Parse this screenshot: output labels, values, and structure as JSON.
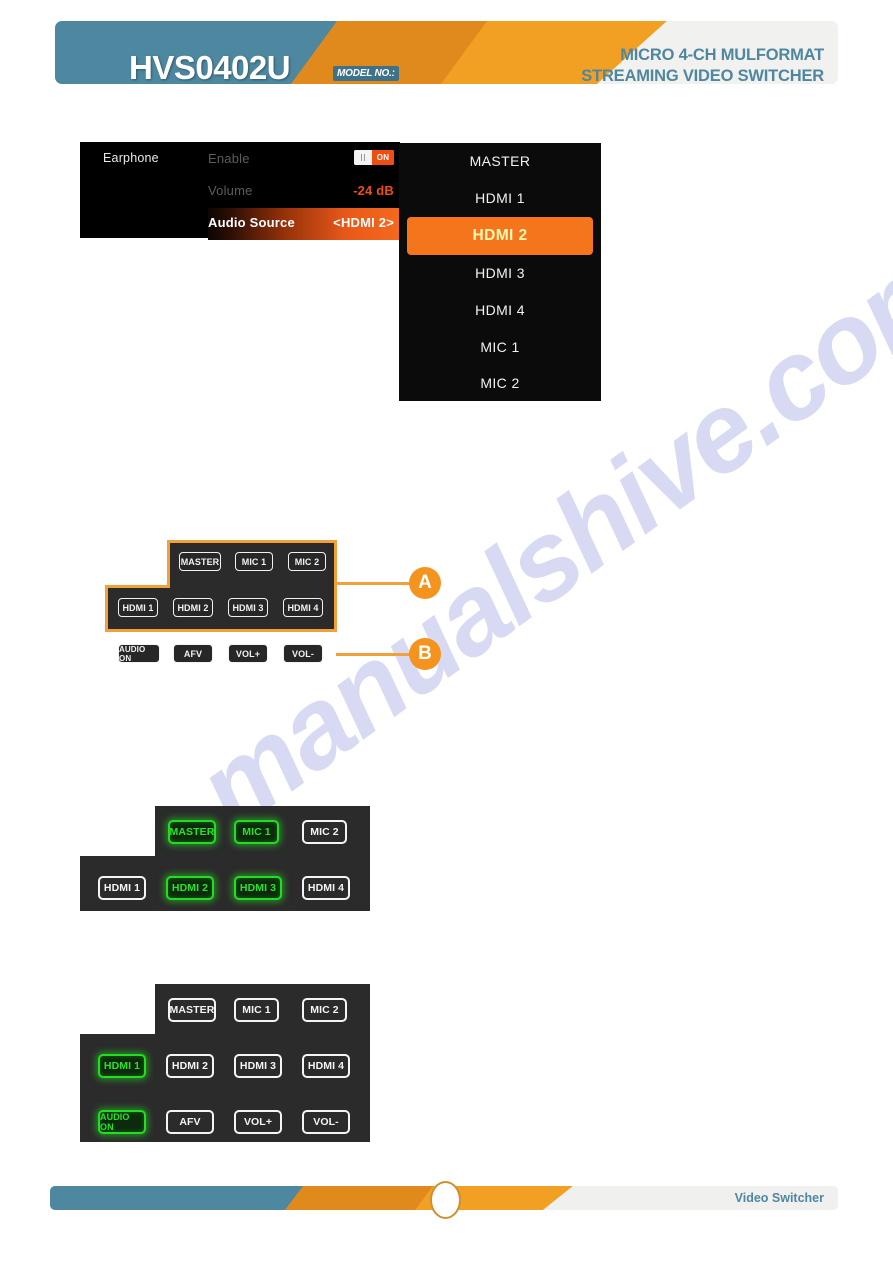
{
  "header": {
    "model": "HVS0402U",
    "model_no_badge": "MODEL NO.:",
    "tagline_line1": "MICRO 4-CH MULFORMAT",
    "tagline_line2": "STREAMING VIDEO SWITCHER",
    "teal": "#4d87a0",
    "orange": "#f2a024",
    "dark_orange": "#e08a1e"
  },
  "watermark": {
    "text": "manualshive.com"
  },
  "osd": {
    "title": "Earphone",
    "rows": [
      {
        "label": "Enable",
        "value": "ON"
      },
      {
        "label": "Volume",
        "value": "-24 dB"
      },
      {
        "label": "Audio Source",
        "value": "<HDMI 2>"
      }
    ],
    "toggle_state": "ON",
    "highlight_color": "#f4751b"
  },
  "dropdown": {
    "items": [
      {
        "label": "MASTER",
        "selected": false
      },
      {
        "label": "HDMI 1",
        "selected": false
      },
      {
        "label": "HDMI 2",
        "selected": true
      },
      {
        "label": "HDMI 3",
        "selected": false
      },
      {
        "label": "HDMI 4",
        "selected": false
      },
      {
        "label": "MIC 1",
        "selected": false
      },
      {
        "label": "MIC 2",
        "selected": false
      }
    ],
    "selected_value": "HDMI 2",
    "selected_bg": "#f4751b",
    "selected_text": "#fff8b0"
  },
  "callout_figure": {
    "group_a_label": "A",
    "group_b_label": "B",
    "group_a_row1": [
      "MASTER",
      "MIC 1",
      "MIC 2"
    ],
    "group_a_row2": [
      "HDMI 1",
      "HDMI 2",
      "HDMI 3",
      "HDMI 4"
    ],
    "group_b_row": [
      "AUDIO ON",
      "AFV",
      "VOL+",
      "VOL-"
    ],
    "outline_color": "#f2a03a",
    "circle_color": "#f4941f"
  },
  "panel_two": {
    "row1": [
      {
        "label": "MASTER",
        "lit": true
      },
      {
        "label": "MIC 1",
        "lit": true
      },
      {
        "label": "MIC 2",
        "lit": false
      }
    ],
    "row2": [
      {
        "label": "HDMI 1",
        "lit": false
      },
      {
        "label": "HDMI 2",
        "lit": true
      },
      {
        "label": "HDMI 3",
        "lit": true
      },
      {
        "label": "HDMI 4",
        "lit": false
      }
    ],
    "lit_color": "#2ae22a"
  },
  "panel_three": {
    "row1": [
      {
        "label": "MASTER",
        "lit": false
      },
      {
        "label": "MIC 1",
        "lit": false
      },
      {
        "label": "MIC 2",
        "lit": false
      }
    ],
    "row2": [
      {
        "label": "HDMI 1",
        "lit": true
      },
      {
        "label": "HDMI 2",
        "lit": false
      },
      {
        "label": "HDMI 3",
        "lit": false
      },
      {
        "label": "HDMI 4",
        "lit": false
      }
    ],
    "row3": [
      {
        "label": "AUDIO ON",
        "lit": true
      },
      {
        "label": "AFV",
        "lit": false
      },
      {
        "label": "VOL+",
        "lit": false
      },
      {
        "label": "VOL-",
        "lit": false
      }
    ],
    "lit_color": "#2ae22a"
  },
  "footer": {
    "label": "Video Switcher"
  }
}
